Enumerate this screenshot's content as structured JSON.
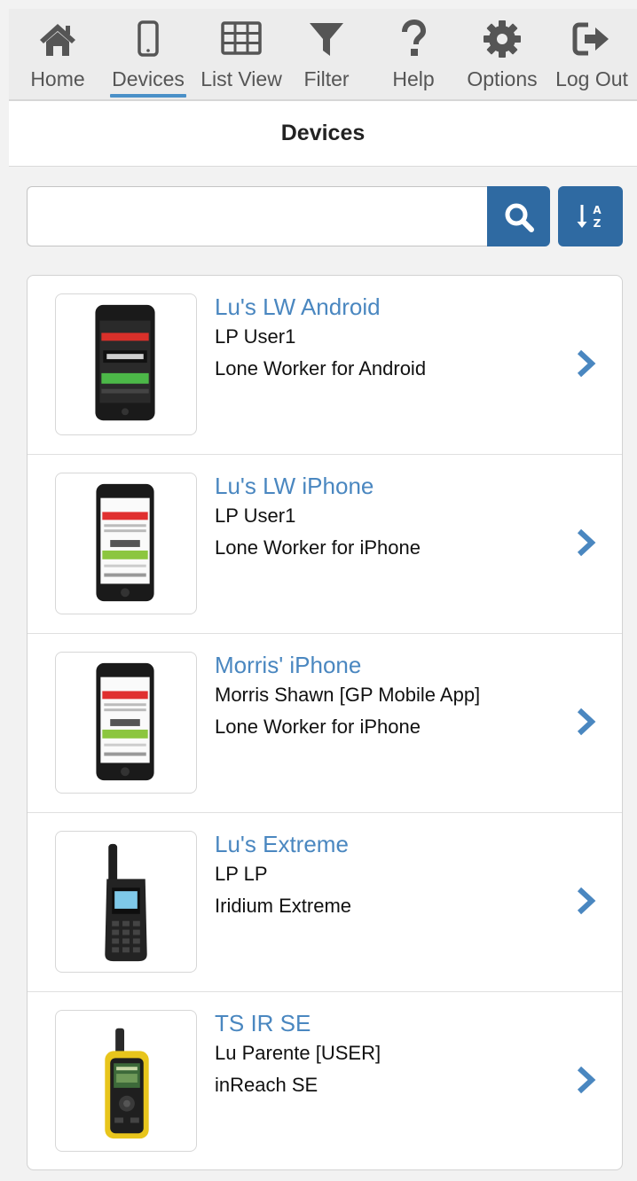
{
  "nav": {
    "items": [
      {
        "label": "Home",
        "icon": "home-icon"
      },
      {
        "label": "Devices",
        "icon": "mobile-phone-icon",
        "active": true
      },
      {
        "label": "List View",
        "icon": "grid-icon"
      },
      {
        "label": "Filter",
        "icon": "filter-icon"
      },
      {
        "label": "Help",
        "icon": "question-icon"
      },
      {
        "label": "Options",
        "icon": "gear-icon"
      },
      {
        "label": "Log Out",
        "icon": "sign-out-icon"
      }
    ]
  },
  "page": {
    "title": "Devices"
  },
  "search": {
    "value": "",
    "placeholder": ""
  },
  "devices": [
    {
      "name": "Lu's LW Android",
      "user": "LP User1",
      "type": "Lone Worker for Android",
      "image": "android-phone-image"
    },
    {
      "name": "Lu's LW iPhone",
      "user": "LP User1",
      "type": "Lone Worker for iPhone",
      "image": "iphone-image"
    },
    {
      "name": "Morris' iPhone",
      "user": "Morris Shawn [GP Mobile App]",
      "type": "Lone Worker for iPhone",
      "image": "iphone-image"
    },
    {
      "name": "Lu's Extreme",
      "user": "LP LP",
      "type": "Iridium Extreme",
      "image": "satellite-phone-image"
    },
    {
      "name": "TS IR SE",
      "user": "Lu Parente [USER]",
      "type": "inReach SE",
      "image": "gps-device-image"
    }
  ],
  "colors": {
    "accent": "#2f6aa2",
    "link": "#4a87c0",
    "nav_underline": "#4a90c8",
    "icon": "#555555"
  }
}
